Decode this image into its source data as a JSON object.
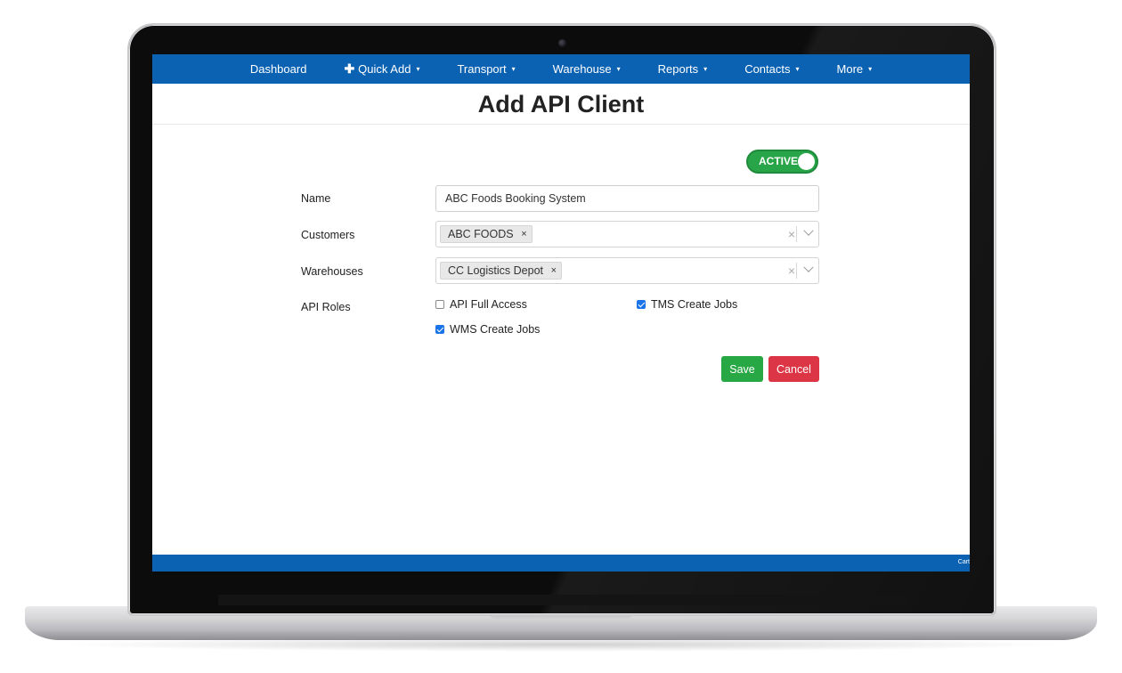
{
  "navbar": {
    "items": [
      {
        "label": "Dashboard",
        "caret": ""
      },
      {
        "label": "Quick Add",
        "caret": "▾",
        "prefix": "✚"
      },
      {
        "label": "Transport",
        "caret": "▾"
      },
      {
        "label": "Warehouse",
        "caret": "▾"
      },
      {
        "label": "Reports",
        "caret": "▾"
      },
      {
        "label": "Contacts",
        "caret": "▾"
      },
      {
        "label": "More",
        "caret": "▾"
      }
    ]
  },
  "page": {
    "title": "Add API Client"
  },
  "status_toggle": {
    "label": "ACTIVE",
    "on": true,
    "color": "#27a548"
  },
  "form": {
    "name_label": "Name",
    "name_value": "ABC Foods Booking System",
    "customers_label": "Customers",
    "customers_selected": [
      "ABC FOODS"
    ],
    "warehouses_label": "Warehouses",
    "warehouses_selected": [
      "CC Logistics Depot"
    ],
    "tag_remove_glyph": "×",
    "clear_glyph": "×",
    "api_roles_label": "API Roles",
    "api_roles": [
      {
        "label": "API Full Access",
        "checked": false
      },
      {
        "label": "TMS Create Jobs",
        "checked": true
      },
      {
        "label": "WMS Create Jobs",
        "checked": true
      }
    ]
  },
  "actions": {
    "save_label": "Save",
    "cancel_label": "Cancel",
    "save_color": "#28a745",
    "cancel_color": "#dc3545"
  },
  "footer": {
    "text": "Cart"
  },
  "theme": {
    "navbar_color": "#0b62b3"
  }
}
